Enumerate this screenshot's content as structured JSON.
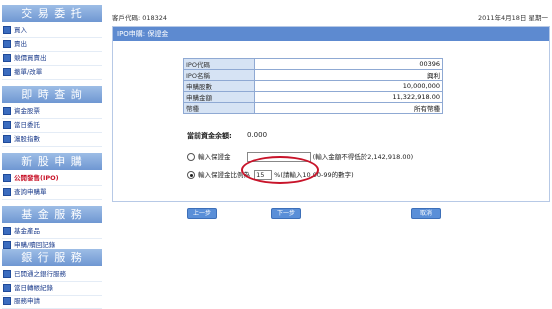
{
  "sidebar": {
    "sections": [
      {
        "title": "交 易 委 托",
        "items": [
          {
            "label": "買入",
            "active": false
          },
          {
            "label": "賣出",
            "active": false
          },
          {
            "label": "競價買賣出",
            "active": false
          },
          {
            "label": "撤單/改單",
            "active": false
          }
        ]
      },
      {
        "title": "即 時 查 詢",
        "items": [
          {
            "label": "資金股票",
            "active": false
          },
          {
            "label": "當日委託",
            "active": false
          },
          {
            "label": "滬股指數",
            "active": false
          }
        ]
      },
      {
        "title": "新 股 申 購",
        "items": [
          {
            "label": "公開發售(IPO)",
            "active": true
          },
          {
            "label": "查詢申購單",
            "active": false
          }
        ]
      },
      {
        "title": "基 金 服 務",
        "items": [
          {
            "label": "基金產品",
            "active": false
          },
          {
            "label": "申購/贖回記錄",
            "active": false
          }
        ]
      },
      {
        "title": "銀 行 服 務",
        "items": [
          {
            "label": "已開通之銀行服務",
            "active": false
          },
          {
            "label": "當日轉帳紀錄",
            "active": false
          },
          {
            "label": "服務申請",
            "active": false
          }
        ]
      }
    ]
  },
  "topbar": {
    "account": "客戶代碼: 018324",
    "date": "2011年4月18日 星期一"
  },
  "panel": {
    "title": "IPO申購: 保證金",
    "rows": [
      {
        "key": "IPO代碼",
        "value": "00396"
      },
      {
        "key": "IPO名稱",
        "value": "興利"
      },
      {
        "key": "申購股數",
        "value": "10,000,000"
      },
      {
        "key": "申購金額",
        "value": "11,322,918.00"
      },
      {
        "key": "幣種",
        "value": "所有幣種"
      }
    ],
    "balance_label": "當前資金余額:",
    "balance_value": "0.000",
    "option1_label": "輸入保證金",
    "option1_hint": "(輸入金額不得低於2,142,918.00)",
    "option2_label": "輸入保證金比例為",
    "option2_value": "15",
    "option2_hint": "%(請輸入10.00-99的數字)",
    "btn_prev": "上一步",
    "btn_next": "下一步",
    "btn_cancel": "取消"
  },
  "colors": {
    "accent": "#5d8ad0",
    "highlight": "#c8142a"
  }
}
